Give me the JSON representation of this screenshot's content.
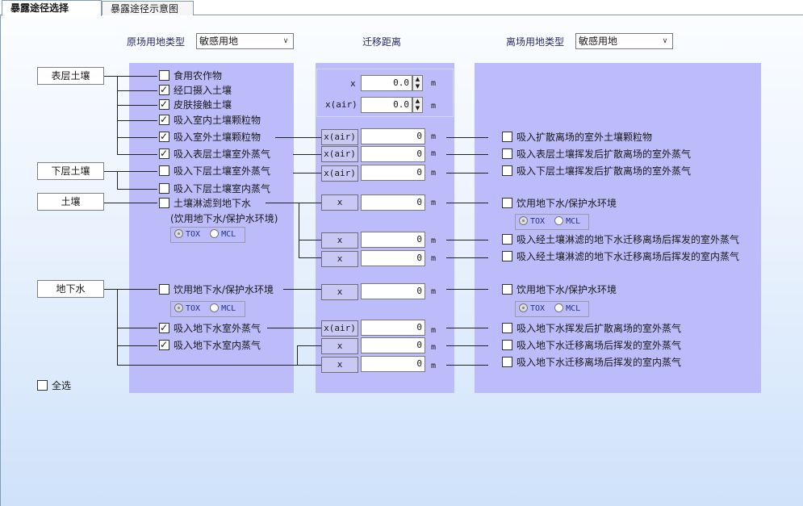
{
  "tabs": [
    "暴露途径选择",
    "暴露途径示意图"
  ],
  "header": {
    "source_site_type_label": "原场用地类型",
    "source_site_type_value": "敏感用地",
    "migration_distance_label": "迁移距离",
    "offsite_type_label": "离场用地类型",
    "offsite_type_value": "敏感用地"
  },
  "media": {
    "surface_soil": "表层土壤",
    "subsurface_soil": "下层土壤",
    "soil": "土壤",
    "groundwater": "地下水"
  },
  "onsite": {
    "food_crops": {
      "label": "食用农作物",
      "checked": false
    },
    "oral_soil": {
      "label": "经口摄入土壤",
      "checked": true
    },
    "dermal_soil": {
      "label": "皮肤接触土壤",
      "checked": true
    },
    "indoor_particles": {
      "label": "吸入室内土壤颗粒物",
      "checked": true
    },
    "outdoor_particles": {
      "label": "吸入室外土壤颗粒物",
      "checked": true
    },
    "surface_outdoor_vapor": {
      "label": "吸入表层土壤室外蒸气",
      "checked": true
    },
    "sub_outdoor_vapor": {
      "label": "吸入下层土壤室外蒸气",
      "checked": false
    },
    "sub_indoor_vapor": {
      "label": "吸入下层土壤室内蒸气",
      "checked": false
    },
    "leach_gw": {
      "label": "土壤淋滤到地下水",
      "checked": false
    },
    "leach_gw_note": "(饮用地下水/保护水环境)",
    "gw_drink": {
      "label": "饮用地下水/保护水环境",
      "checked": false
    },
    "gw_outdoor_vapor": {
      "label": "吸入地下水室外蒸气",
      "checked": true
    },
    "gw_indoor_vapor": {
      "label": "吸入地下水室内蒸气",
      "checked": true
    }
  },
  "distance": {
    "x_label": "x",
    "x_air_label": "x(air)",
    "top_x": "0.0",
    "top_x_air": "0.0",
    "unit": "m",
    "rows": [
      {
        "tag": "x(air)",
        "value": "0"
      },
      {
        "tag": "x(air)",
        "value": "0"
      },
      {
        "tag": "x(air)",
        "value": "0"
      },
      {
        "tag": "x",
        "value": "0"
      },
      {
        "tag": "x",
        "value": "0"
      },
      {
        "tag": "x",
        "value": "0"
      },
      {
        "tag": "x",
        "value": "0"
      },
      {
        "tag": "x(air)",
        "value": "0"
      },
      {
        "tag": "x",
        "value": "0"
      },
      {
        "tag": "x",
        "value": "0"
      }
    ]
  },
  "offsite": {
    "particles": "吸入扩散离场的室外土壤颗粒物",
    "surface_vapor": "吸入表层土壤挥发后扩散离场的室外蒸气",
    "sub_vapor": "吸入下层土壤挥发后扩散离场的室外蒸气",
    "drink_gw_1": "饮用地下水/保护水环境",
    "leach_outdoor": "吸入经土壤淋滤的地下水迁移离场后挥发的室外蒸气",
    "leach_indoor": "吸入经土壤淋滤的地下水迁移离场后挥发的室内蒸气",
    "drink_gw_2": "饮用地下水/保护水环境",
    "gw_diffuse_outdoor": "吸入地下水挥发后扩散离场的室外蒸气",
    "gw_migrate_outdoor": "吸入地下水迁移离场后挥发的室外蒸气",
    "gw_migrate_indoor": "吸入地下水迁移离场后挥发的室内蒸气"
  },
  "radio": {
    "tox": "TOX",
    "mcl": "MCL"
  },
  "select_all": "全选"
}
